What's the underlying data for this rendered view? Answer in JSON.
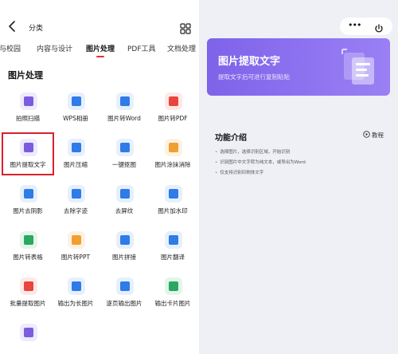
{
  "header": {
    "title": "分类"
  },
  "tabs": [
    "职与校园",
    "内容与设计",
    "图片处理",
    "PDF工具",
    "文档处理"
  ],
  "section_title": "图片处理",
  "tools": [
    {
      "label": "拍照扫描",
      "icon": "scan-icon",
      "color": "#7b5ce0",
      "bg": "#efeafd"
    },
    {
      "label": "WPS相册",
      "icon": "album-icon",
      "color": "#2f7be8",
      "bg": "#e6f0fd"
    },
    {
      "label": "图片转Word",
      "icon": "image-to-word-icon",
      "color": "#2f7be8",
      "bg": "#e6f0fd"
    },
    {
      "label": "图片转PDF",
      "icon": "image-to-pdf-icon",
      "color": "#e8453c",
      "bg": "#fde9e8"
    },
    {
      "label": "图片提取文字",
      "icon": "extract-text-icon",
      "color": "#7b5ce0",
      "bg": "#efeafd"
    },
    {
      "label": "图片压缩",
      "icon": "compress-icon",
      "color": "#2f7be8",
      "bg": "#e6f0fd"
    },
    {
      "label": "一键抠图",
      "icon": "cutout-icon",
      "color": "#2f7be8",
      "bg": "#e6f0fd"
    },
    {
      "label": "图片涂抹消除",
      "icon": "eraser-icon",
      "color": "#f0a030",
      "bg": "#fdf2e2"
    },
    {
      "label": "图片去阴影",
      "icon": "remove-shadow-icon",
      "color": "#2f7be8",
      "bg": "#e6f0fd"
    },
    {
      "label": "去除字迹",
      "icon": "remove-handwriting-icon",
      "color": "#2f7be8",
      "bg": "#e6f0fd"
    },
    {
      "label": "去屏纹",
      "icon": "moire-icon",
      "color": "#2f7be8",
      "bg": "#e6f0fd"
    },
    {
      "label": "图片加水印",
      "icon": "watermark-icon",
      "color": "#2f7be8",
      "bg": "#e6f0fd"
    },
    {
      "label": "图片转表格",
      "icon": "image-to-table-icon",
      "color": "#28a860",
      "bg": "#e3f5ea"
    },
    {
      "label": "图片转PPT",
      "icon": "image-to-ppt-icon",
      "color": "#f0a030",
      "bg": "#fdf2e2"
    },
    {
      "label": "图片拼接",
      "icon": "stitch-icon",
      "color": "#2f7be8",
      "bg": "#e6f0fd"
    },
    {
      "label": "图片翻译",
      "icon": "translate-icon",
      "color": "#2f7be8",
      "bg": "#e6f0fd"
    },
    {
      "label": "批量提取图片",
      "icon": "batch-extract-icon",
      "color": "#e8453c",
      "bg": "#fde9e8"
    },
    {
      "label": "输出为长图片",
      "icon": "long-image-icon",
      "color": "#2f7be8",
      "bg": "#e6f0fd"
    },
    {
      "label": "逐页输出图片",
      "icon": "page-output-icon",
      "color": "#2f7be8",
      "bg": "#e6f0fd"
    },
    {
      "label": "输出卡片图片",
      "icon": "card-image-icon",
      "color": "#28a860",
      "bg": "#e3f5ea"
    },
    {
      "label": "",
      "icon": "grid-tool-icon",
      "color": "#7b5ce0",
      "bg": "#efeafd"
    }
  ],
  "banner": {
    "title": "图片提取文字",
    "subtitle": "提取文字后可进行复制粘贴",
    "color_start": "#7e63ea",
    "color_end": "#9a80f4"
  },
  "intro": {
    "title": "功能介绍",
    "tutorial_label": "教程",
    "bullets": [
      "选择图片，选择识别区域，开始识别",
      "识别图片中文字转为纯文本，或导出为Word",
      "仅支持识别印刷体文字"
    ]
  },
  "colors": {
    "accent_red": "#e8302a",
    "highlight_red": "#d9202a",
    "right_bg": "#eef0f6"
  }
}
